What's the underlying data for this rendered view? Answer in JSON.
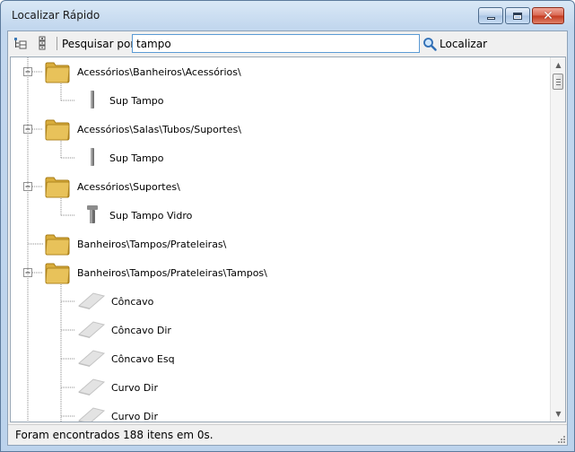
{
  "window": {
    "title": "Localizar Rápido",
    "close_glyph": "✕"
  },
  "toolbar": {
    "expand_icon": "tree-expand-icon",
    "collapse_icon": "tree-collapse-icon",
    "search_label": "Pesquisar por:",
    "search_value": "tampo",
    "find_label": "Localizar",
    "find_icon": "magnifier-icon"
  },
  "tree": {
    "folders": [
      {
        "label": "Acessórios\\Banheiros\\Acessórios\\",
        "children": [
          {
            "label": "Sup Tampo",
            "icon": "support-icon"
          }
        ]
      },
      {
        "label": "Acessórios\\Salas\\Tubos/Suportes\\",
        "children": [
          {
            "label": "Sup Tampo",
            "icon": "support-icon"
          }
        ]
      },
      {
        "label": "Acessórios\\Suportes\\",
        "children": [
          {
            "label": "Sup Tampo Vidro",
            "icon": "glass-support-icon"
          }
        ]
      },
      {
        "label": "Banheiros\\Tampos/Prateleiras\\",
        "children": []
      },
      {
        "label": "Banheiros\\Tampos/Prateleiras\\Tampos\\",
        "children": [
          {
            "label": "Côncavo",
            "icon": "countertop-icon"
          },
          {
            "label": "Côncavo Dir",
            "icon": "countertop-icon"
          },
          {
            "label": "Côncavo Esq",
            "icon": "countertop-icon"
          },
          {
            "label": "Curvo Dir",
            "icon": "countertop-icon"
          },
          {
            "label": "Curvo Dir",
            "icon": "countertop-icon"
          }
        ]
      }
    ]
  },
  "status": {
    "text": "Foram encontrados 188 itens em 0s."
  },
  "colors": {
    "folder": "#e8c25a",
    "accent": "#5b9bd5"
  }
}
